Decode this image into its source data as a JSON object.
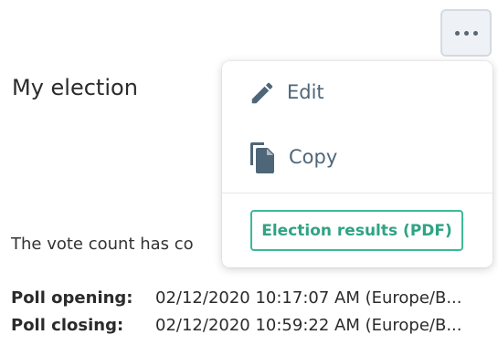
{
  "election": {
    "title": "My election",
    "status_text": "The vote count has co"
  },
  "poll": {
    "opening_label": "Poll opening:",
    "opening_value": "02/12/2020 10:17:07 AM (Europe/B...",
    "closing_label": "Poll closing:",
    "closing_value": "02/12/2020 10:59:22 AM (Europe/B..."
  },
  "menu": {
    "trigger_icon": "more-horizontal-icon",
    "items": [
      {
        "label": "Edit",
        "icon": "pencil-icon"
      },
      {
        "label": "Copy",
        "icon": "copy-icon"
      }
    ],
    "results_button_label": "Election results (PDF)"
  },
  "colors": {
    "menu_text": "#4e6678",
    "accent_green": "#3db896",
    "trigger_bg": "#eef1f5"
  }
}
